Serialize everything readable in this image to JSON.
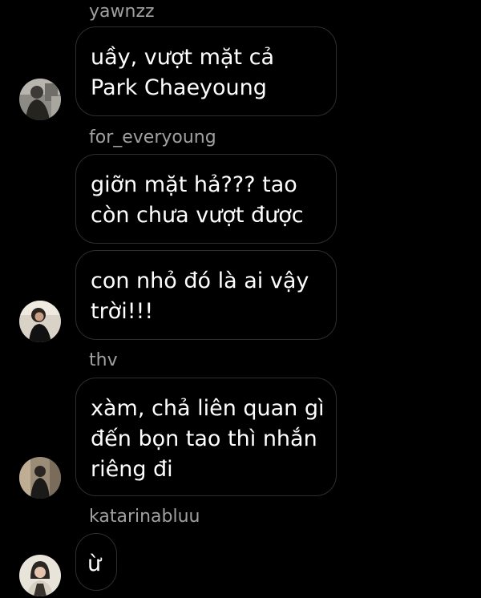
{
  "messages": [
    {
      "sender": "yawnzz",
      "lines": [
        "uầy, vượt mặt cả",
        "Park Chaeyoung"
      ],
      "avatar_icon": "user-avatar-photo"
    },
    {
      "sender": "for_everyoung",
      "lines": [
        "giỡn mặt hả??? tao",
        "còn chưa vượt được"
      ],
      "avatar_icon": ""
    },
    {
      "sender": "",
      "lines": [
        "con nhỏ đó là ai vậy",
        "trời!!!"
      ],
      "avatar_icon": "user-avatar-photo"
    },
    {
      "sender": "thv",
      "lines": [
        "xàm, chả liên quan gì",
        "đến bọn tao thì nhắn",
        "riêng đi"
      ],
      "avatar_icon": "user-avatar-photo"
    },
    {
      "sender": "katarinabluu",
      "lines": [
        "ừ"
      ],
      "avatar_icon": "user-avatar-photo"
    }
  ],
  "colors": {
    "background": "#000000",
    "bubble_border": "#2e2e2e",
    "username": "#a0a0a0",
    "text": "#ffffff"
  }
}
